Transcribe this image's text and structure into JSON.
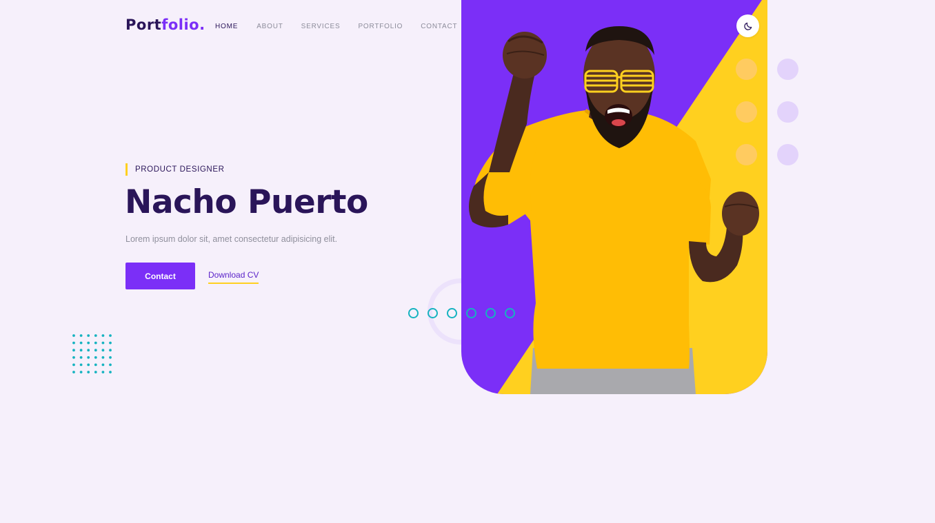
{
  "brand": {
    "logo_main": "Port",
    "logo_accent": "folio."
  },
  "nav": {
    "items": [
      {
        "label": "HOME",
        "active": true
      },
      {
        "label": "ABOUT",
        "active": false
      },
      {
        "label": "SERVICES",
        "active": false
      },
      {
        "label": "PORTFOLIO",
        "active": false
      },
      {
        "label": "CONTACT",
        "active": false
      }
    ]
  },
  "hero": {
    "role": "PRODUCT DESIGNER",
    "name": "Nacho Puerto",
    "description": "Lorem ipsum dolor sit, amet consectetur adipisicing elit.",
    "contact_label": "Contact",
    "download_label": "Download CV"
  },
  "theme_toggle": {
    "icon": "moon-icon"
  },
  "slider": {
    "dot_count": 6
  },
  "colors": {
    "background": "#f6f0fb",
    "primary": "#7b2ff7",
    "accent_yellow": "#ffd01f",
    "heading": "#2a1559",
    "teal": "#16b3c0",
    "peach": "#ffc977",
    "lavender": "#e3d3fb"
  }
}
